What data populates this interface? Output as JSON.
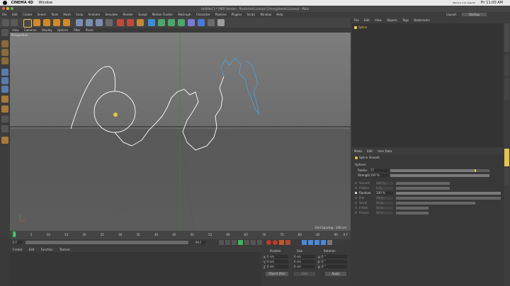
{
  "mac_menubar": {
    "app": "CINEMA 4D",
    "menus": [
      "Window"
    ],
    "clock": "Fri 11:00 AM",
    "battery": "Memory 4 (0 objects)"
  },
  "window_title": "Untitled 1 * [NFR Version - Restricted License] (Unregistered License) - Main",
  "main_menu": [
    "File",
    "Edit",
    "Create",
    "Select",
    "Tools",
    "Mesh",
    "Snap",
    "Animate",
    "Simulate",
    "Render",
    "Sculpt",
    "Motion Tracker",
    "MoGraph",
    "Character",
    "Pipeline",
    "Plugins",
    "Script",
    "Window",
    "Help"
  ],
  "layout": {
    "label": "Layout:",
    "value": "Startup"
  },
  "viewport": {
    "menu": [
      "View",
      "Cameras",
      "Display",
      "Options",
      "Filter",
      "Panel"
    ],
    "camera_label": "Perspective",
    "grid_spacing": "Grid Spacing : 100 cm"
  },
  "timeline": {
    "ticks": [
      "0",
      "5",
      "10",
      "15",
      "20",
      "25",
      "30",
      "35",
      "40",
      "45",
      "50",
      "55",
      "60",
      "65",
      "70",
      "75",
      "80",
      "85",
      "90"
    ],
    "start_frame": "0 F",
    "end_frame": "90 F",
    "current_frame": "0 F",
    "end_field": "90 F"
  },
  "material_manager": {
    "menu": [
      "Create",
      "Edit",
      "Function",
      "Texture"
    ]
  },
  "coordinates": {
    "headers": [
      "Position",
      "Size",
      "Rotation"
    ],
    "rows": [
      {
        "axis": "X",
        "pos": "0 cm",
        "size": "0 cm",
        "rot_axis": "H",
        "rot": "0 °"
      },
      {
        "axis": "Y",
        "pos": "0 cm",
        "size": "0 cm",
        "rot_axis": "P",
        "rot": "0 °"
      },
      {
        "axis": "Z",
        "pos": "0 cm",
        "size": "0 cm",
        "rot_axis": "B",
        "rot": "0 °"
      }
    ],
    "mode": "Object (Rel)",
    "size_mode": "Size",
    "apply": "Apply"
  },
  "object_manager": {
    "menu": [
      "File",
      "Edit",
      "View",
      "Objects",
      "Tags",
      "Bookmarks"
    ],
    "items": [
      "Spline"
    ]
  },
  "attribute_manager": {
    "menu": [
      "Mode",
      "Edit",
      "User Data"
    ],
    "title": "Spline Smooth",
    "section": "Options",
    "rows": [
      {
        "label": "Radius",
        "value": "77",
        "fill": 0.85
      },
      {
        "label": "Strength",
        "value": "100 %",
        "fill": 1.0
      }
    ],
    "checks": [
      {
        "label": "Smooth",
        "value": "100 %",
        "checked": false,
        "fill": 0.6
      },
      {
        "label": "Flatten",
        "value": "0 %",
        "checked": false,
        "fill": 0.6
      },
      {
        "label": "Random",
        "value": "100 %",
        "checked": true,
        "fill": 1.0
      },
      {
        "label": "Pull",
        "value": "50 %",
        "checked": false,
        "fill": 1.0
      },
      {
        "label": "Spiral",
        "value": "50 %",
        "checked": false,
        "fill": 0.75
      },
      {
        "label": "Inflate",
        "value": "50 %",
        "checked": false,
        "fill": 0.3
      },
      {
        "label": "Project",
        "value": "50 %",
        "checked": false,
        "fill": 0.3
      }
    ]
  },
  "colors": {
    "accent": "#e7c44a",
    "selection_blue": "#4aa3e8",
    "viewport_bg": "#707070"
  }
}
